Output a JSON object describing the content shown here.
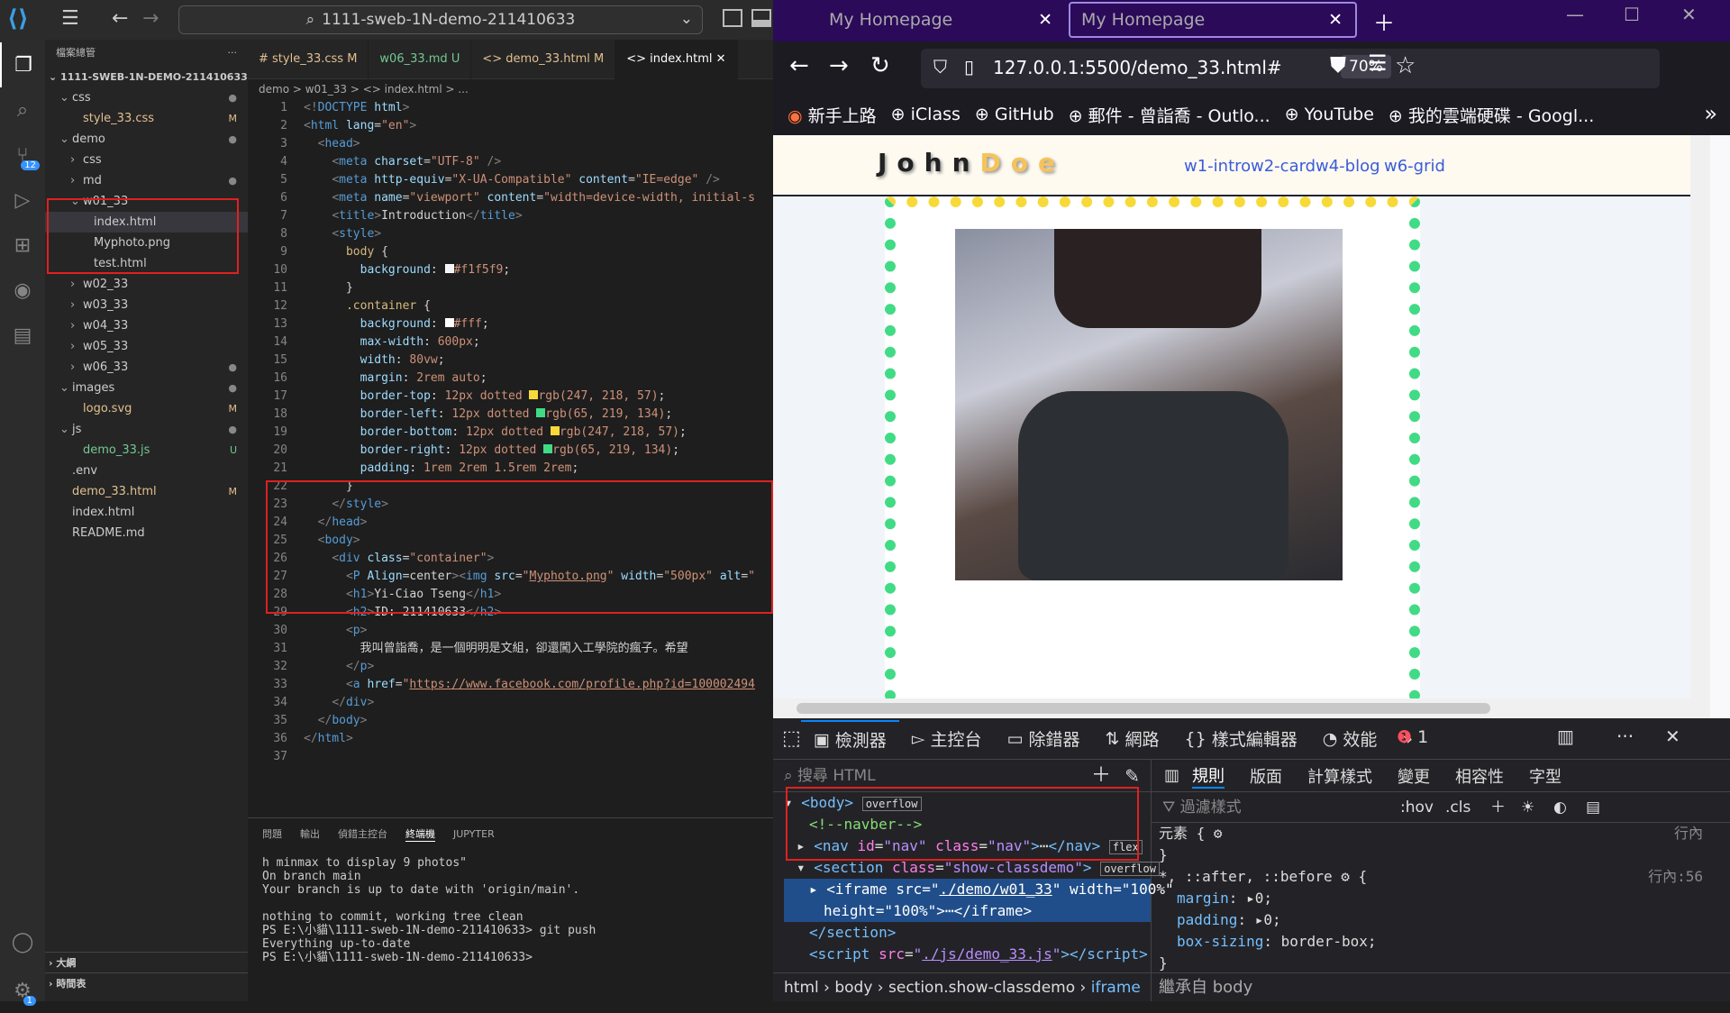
{
  "vscode": {
    "project": "1111-sweb-1N-demo-211410633",
    "explorer_title": "檔案總管",
    "explorer_root": "1111-SWEB-1N-DEMO-211410633",
    "tree": [
      {
        "label": "css",
        "badge": "●",
        "indent": 1,
        "chevron": "v"
      },
      {
        "label": "style_33.css",
        "badge": "M",
        "indent": 2,
        "chevron": ""
      },
      {
        "label": "demo",
        "badge": "●",
        "indent": 1,
        "chevron": "v"
      },
      {
        "label": "css",
        "badge": "",
        "indent": 2,
        "chevron": ">"
      },
      {
        "label": "md",
        "badge": "●",
        "indent": 2,
        "chevron": ">"
      },
      {
        "label": "w01_33",
        "badge": "",
        "indent": 2,
        "chevron": "v"
      },
      {
        "label": "index.html",
        "badge": "",
        "indent": 3,
        "chevron": ""
      },
      {
        "label": "Myphoto.png",
        "badge": "",
        "indent": 3,
        "chevron": ""
      },
      {
        "label": "test.html",
        "badge": "",
        "indent": 3,
        "chevron": ""
      },
      {
        "label": "w02_33",
        "badge": "",
        "indent": 2,
        "chevron": ">"
      },
      {
        "label": "w03_33",
        "badge": "",
        "indent": 2,
        "chevron": ">"
      },
      {
        "label": "w04_33",
        "badge": "",
        "indent": 2,
        "chevron": ">"
      },
      {
        "label": "w05_33",
        "badge": "",
        "indent": 2,
        "chevron": ">"
      },
      {
        "label": "w06_33",
        "badge": "●",
        "indent": 2,
        "chevron": ">"
      },
      {
        "label": "images",
        "badge": "●",
        "indent": 1,
        "chevron": "v"
      },
      {
        "label": "logo.svg",
        "badge": "M",
        "indent": 2,
        "chevron": ""
      },
      {
        "label": "js",
        "badge": "●",
        "indent": 1,
        "chevron": "v"
      },
      {
        "label": "demo_33.js",
        "badge": "U",
        "indent": 2,
        "chevron": ""
      },
      {
        "label": ".env",
        "badge": "",
        "indent": 1,
        "chevron": ""
      },
      {
        "label": "demo_33.html",
        "badge": "M",
        "indent": 1,
        "chevron": ""
      },
      {
        "label": "index.html",
        "badge": "",
        "indent": 1,
        "chevron": ""
      },
      {
        "label": "README.md",
        "badge": "",
        "indent": 1,
        "chevron": ""
      }
    ],
    "outline": "大綱",
    "timeline": "時間表",
    "scm_badge": "12",
    "settings_badge": "1",
    "tabs": [
      "# style_33.css M",
      "w06_33.md U",
      "<> demo_33.html M",
      "<> index.html"
    ],
    "breadcrumb": "demo > w01_33 > <> index.html > ...",
    "panel_tabs": [
      "問題",
      "輸出",
      "偵錯主控台",
      "終端機",
      "JUPYTER"
    ],
    "terminal": [
      "h minmax to display 9 photos\"",
      "On branch main",
      "Your branch is up to date with 'origin/main'.",
      "",
      "nothing to commit, working tree clean",
      "PS E:\\小貓\\1111-sweb-1N-demo-211410633> git push",
      "Everything up-to-date",
      "PS E:\\小貓\\1111-sweb-1N-demo-211410633> "
    ]
  },
  "browser": {
    "tabs": [
      "My Homepage",
      "My Homepage"
    ],
    "url": "127.0.0.1:5500/demo_33.html#",
    "zoom": "70%",
    "bookmarks": [
      "新手上路",
      "iClass",
      "GitHub",
      "郵件 - 曾詣喬 - Outlo...",
      "YouTube",
      "我的雲端硬碟 - Googl..."
    ],
    "logo_first": "John",
    "logo_last": "Doe",
    "nav_links": [
      "w1-intro",
      "w2-card",
      "w4-blog",
      "w6-grid"
    ]
  },
  "devtools": {
    "tabs": [
      "檢測器",
      "主控台",
      "除錯器",
      "網路",
      "樣式編輯器",
      "效能"
    ],
    "error_count": "1",
    "search_placeholder": "搜尋 HTML",
    "right_tabs": [
      "規則",
      "版面",
      "計算樣式",
      "變更",
      "相容性",
      "字型"
    ],
    "filter_placeholder": "過濾樣式",
    "hov": ":hov",
    "cls": ".cls",
    "element_rule": "元素 {",
    "inline": "行內",
    "universal": "*, ::after, ::before",
    "universal_src": "行內:56",
    "inherit": "繼承自 body",
    "breadcrumbs": [
      "html",
      "body",
      "section.show-classdemo",
      "iframe"
    ]
  }
}
